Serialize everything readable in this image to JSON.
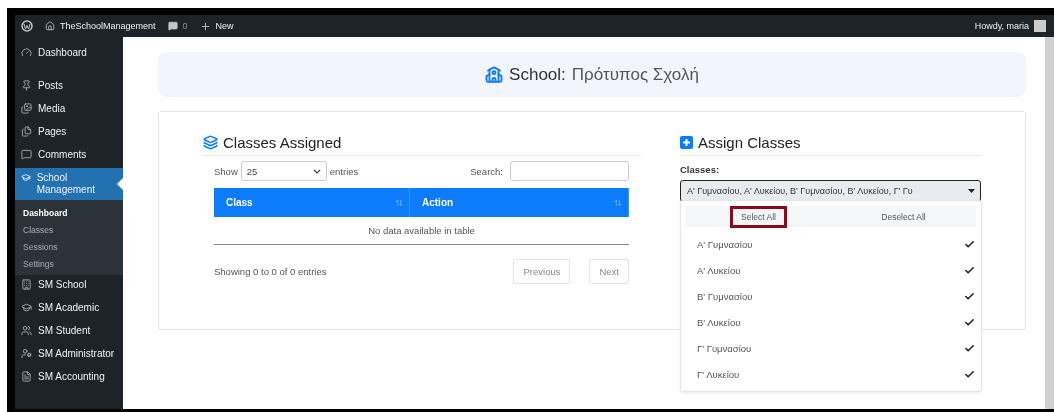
{
  "admin_bar": {
    "site": "TheSchoolManagement",
    "comments": "0",
    "new": "New",
    "greeting": "Howdy, maria"
  },
  "sidebar": {
    "items": [
      {
        "label": "Dashboard",
        "selected": false
      },
      {
        "label": "Posts",
        "selected": false
      },
      {
        "label": "Media",
        "selected": false
      },
      {
        "label": "Pages",
        "selected": false
      },
      {
        "label": "Comments",
        "selected": false
      },
      {
        "label": "School Management",
        "selected": true,
        "submenu": [
          {
            "label": "Dashboard",
            "selected": true
          },
          {
            "label": "Classes",
            "selected": false
          },
          {
            "label": "Sessions",
            "selected": false
          },
          {
            "label": "Settings",
            "selected": false
          }
        ]
      },
      {
        "label": "SM School",
        "selected": false
      },
      {
        "label": "SM Academic",
        "selected": false
      },
      {
        "label": "SM Student",
        "selected": false
      },
      {
        "label": "SM Administrator",
        "selected": false
      },
      {
        "label": "SM Accounting",
        "selected": false
      }
    ]
  },
  "header": {
    "label": "School:",
    "value": "Πρότυπος Σχολή"
  },
  "classes_assigned": {
    "title": "Classes Assigned",
    "show_label": "Show",
    "page_length": "25",
    "entries_label": "entries",
    "search_label": "Search:",
    "columns": [
      "Class",
      "Action"
    ],
    "empty_message": "No data available in table",
    "info": "Showing 0 to 0 of 0 entries",
    "buttons": [
      "Previous",
      "Next"
    ]
  },
  "assign_classes": {
    "title": "Assign Classes",
    "field_label": "Classes:",
    "value": "Α' Γυμνασίου, Α' Λυκείου, Β' Γυμνασίου, Β' Λυκείου, Γ' Γυ",
    "actions": [
      {
        "label": "Select All",
        "highlighted": true
      },
      {
        "label": "Deselect All",
        "highlighted": false
      }
    ],
    "options": [
      {
        "label": "Α' Γυμνασίου",
        "checked": true
      },
      {
        "label": "Α' Λυκείου",
        "checked": true
      },
      {
        "label": "Β' Γυμνασίου",
        "checked": true
      },
      {
        "label": "Β' Λυκείου",
        "checked": true
      },
      {
        "label": "Γ' Γυμνασίου",
        "checked": true
      },
      {
        "label": "Γ' Λυκείου",
        "checked": true
      }
    ]
  }
}
